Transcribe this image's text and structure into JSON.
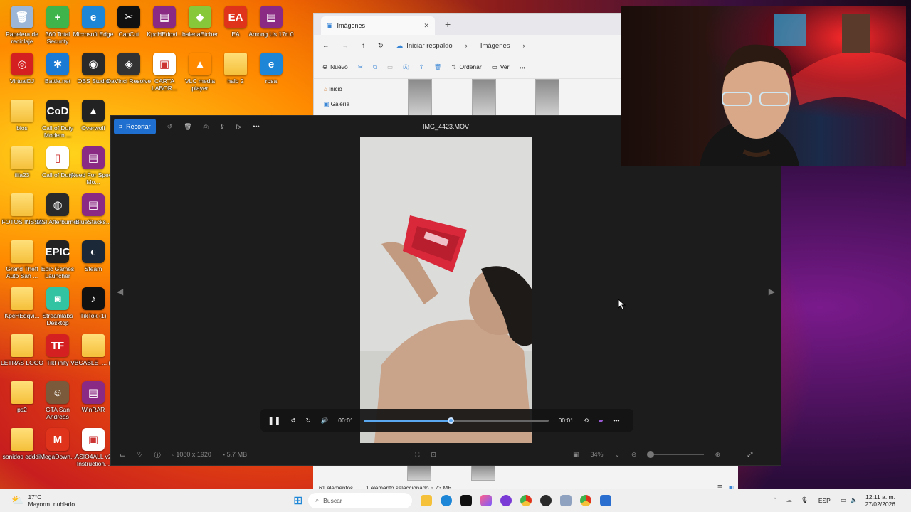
{
  "desktop": {
    "icons": [
      {
        "label": "Papelera de reciclaje",
        "color": "#9bb6d6",
        "glyph": "🗑"
      },
      {
        "label": "360 Total Security",
        "color": "#3fb44a",
        "glyph": "+"
      },
      {
        "label": "Microsoft Edge",
        "color": "#1d86d6",
        "glyph": "e"
      },
      {
        "label": "CapCut",
        "color": "#111111",
        "glyph": "✂"
      },
      {
        "label": "KpcHEdqvi...",
        "color": "#8b2a84",
        "glyph": "▤"
      },
      {
        "label": "balenaEtcher",
        "color": "#86c83a",
        "glyph": "◆"
      },
      {
        "label": "EA",
        "color": "#e0331b",
        "glyph": "EA"
      },
      {
        "label": "Among Us 17rl.0",
        "color": "#8b2a84",
        "glyph": "▤"
      },
      {
        "label": "VirtualDJ",
        "color": "#d42020",
        "glyph": "◎"
      },
      {
        "label": "Battle.net",
        "color": "#1a7ad4",
        "glyph": "✱"
      },
      {
        "label": "OBS Studio",
        "color": "#2a2a2a",
        "glyph": "◉"
      },
      {
        "label": "DaVinci Resolve",
        "color": "#333333",
        "glyph": "◈"
      },
      {
        "label": "CARTA LABOR...",
        "color": "#ffffff",
        "glyph": "▣"
      },
      {
        "label": "VLC media player",
        "color": "#ff8a00",
        "glyph": "▲"
      },
      {
        "label": "halo 2",
        "color": "#f5c03a",
        "glyph": ""
      },
      {
        "label": "rosa",
        "color": "#1d86d6",
        "glyph": "e"
      },
      {
        "label": "bios",
        "color": "#f5c03a",
        "glyph": ""
      },
      {
        "label": "Call of Duty Modern ...",
        "color": "#222222",
        "glyph": "CoD"
      },
      {
        "label": "Overwolf",
        "color": "#222222",
        "glyph": "▲"
      },
      {
        "label": "fifa23",
        "color": "#f5c03a",
        "glyph": ""
      },
      {
        "label": "Call of Duty",
        "color": "#ffffff",
        "glyph": "▯"
      },
      {
        "label": "Need For Speed Mo...",
        "color": "#8b2a84",
        "glyph": "▤"
      },
      {
        "label": "FOTOS INSSS",
        "color": "#f5c03a",
        "glyph": ""
      },
      {
        "label": "MSI Afterburner",
        "color": "#2a2a2a",
        "glyph": "◍"
      },
      {
        "label": "BlueStacks...",
        "color": "#8b2a84",
        "glyph": "▤"
      },
      {
        "label": "Grand Theft Auto San ...",
        "color": "#f5c03a",
        "glyph": ""
      },
      {
        "label": "Epic Games Launcher",
        "color": "#222222",
        "glyph": "EPIC"
      },
      {
        "label": "Steam",
        "color": "#1b2838",
        "glyph": "◐"
      },
      {
        "label": "KpcHEdqvi...",
        "color": "#f5c03a",
        "glyph": ""
      },
      {
        "label": "Streamlabs Desktop",
        "color": "#31c3a2",
        "glyph": "◙"
      },
      {
        "label": "TikTok (1)",
        "color": "#111111",
        "glyph": "♪"
      },
      {
        "label": "LETRAS LOGO",
        "color": "#f5c03a",
        "glyph": ""
      },
      {
        "label": "TikFinity",
        "color": "#d42020",
        "glyph": "TF"
      },
      {
        "label": "VBCABLE_... (3)",
        "color": "#f5c03a",
        "glyph": ""
      },
      {
        "label": "ps2",
        "color": "#f5c03a",
        "glyph": ""
      },
      {
        "label": "GTA San Andreas",
        "color": "#7a5a3a",
        "glyph": "☺"
      },
      {
        "label": "WinRAR",
        "color": "#8b2a84",
        "glyph": "▤"
      },
      {
        "label": "sonidos edddit",
        "color": "#f5c03a",
        "glyph": ""
      },
      {
        "label": "MegaDown...",
        "color": "#e0331b",
        "glyph": "M"
      },
      {
        "label": "ASIO4ALL v2 Instruction...",
        "color": "#ffffff",
        "glyph": "▣"
      }
    ]
  },
  "explorer": {
    "tab_label": "Imágenes",
    "new_tab": "+",
    "backup_label": "Iniciar respaldo",
    "breadcrumb": "Imágenes",
    "new_label": "Nuevo",
    "sort_label": "Ordenar",
    "view_label": "Ver",
    "nav_items": [
      "Inicio",
      "Galería"
    ],
    "status_count": "61 elementos",
    "status_selected": "1 elemento seleccionado  5,73 MB"
  },
  "photos": {
    "crop_label": "Recortar",
    "title": "IMG_4423.MOV",
    "time_elapsed": "00:01",
    "time_total": "00:01",
    "progress": 0.47,
    "dimensions": "1080 x 1920",
    "file_size": "5.7 MB",
    "zoom": "34%"
  },
  "taskbar": {
    "temperature": "17°C",
    "weather": "Mayorm. nublado",
    "search_placeholder": "Buscar",
    "language": "ESP",
    "time": "12:11 a. m.",
    "date": "27/02/2026"
  }
}
